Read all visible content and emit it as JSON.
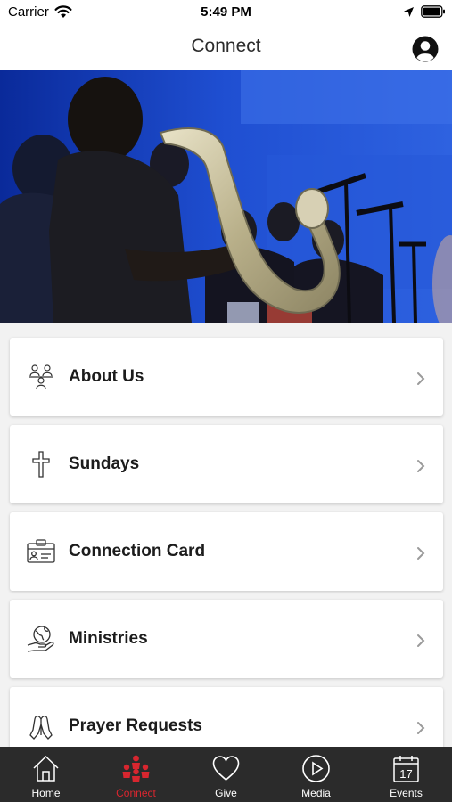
{
  "status_bar": {
    "carrier": "Carrier",
    "time": "5:49 PM"
  },
  "nav": {
    "title": "Connect"
  },
  "menu": {
    "items": [
      {
        "label": "About Us",
        "icon": "people-icon"
      },
      {
        "label": "Sundays",
        "icon": "cross-icon"
      },
      {
        "label": "Connection Card",
        "icon": "id-card-icon"
      },
      {
        "label": "Ministries",
        "icon": "globe-hand-icon"
      },
      {
        "label": "Prayer Requests",
        "icon": "praying-hands-icon"
      }
    ]
  },
  "tabs": [
    {
      "label": "Home",
      "icon": "home-icon",
      "active": false
    },
    {
      "label": "Connect",
      "icon": "group-icon",
      "active": true
    },
    {
      "label": "Give",
      "icon": "heart-icon",
      "active": false
    },
    {
      "label": "Media",
      "icon": "play-icon",
      "active": false
    },
    {
      "label": "Events",
      "icon": "calendar-icon",
      "active": false,
      "calendar_day": "17"
    }
  ],
  "colors": {
    "accent": "#d8262f",
    "tab_bar": "#2b2b2b",
    "hero_blue": "#1e4fd0"
  }
}
